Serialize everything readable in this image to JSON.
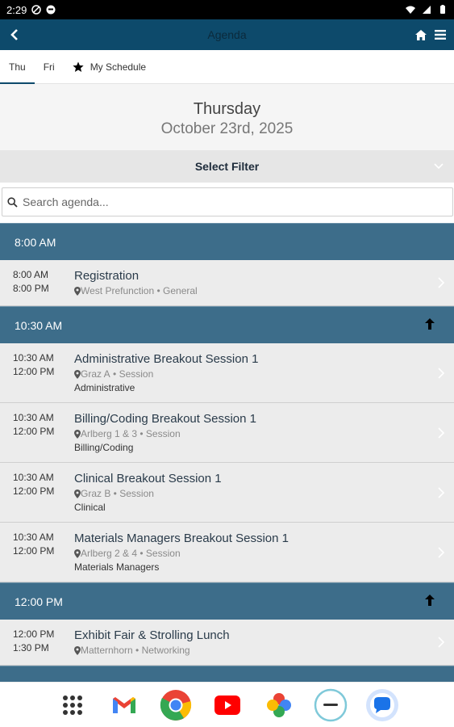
{
  "status_bar": {
    "time": "2:29"
  },
  "app_bar": {
    "title": "Agenda"
  },
  "tabs": [
    {
      "label": "Thu",
      "active": true
    },
    {
      "label": "Fri",
      "active": false
    },
    {
      "label": "My Schedule",
      "active": false,
      "icon": "star-icon"
    }
  ],
  "day": {
    "name": "Thursday",
    "date": "October 23rd, 2025"
  },
  "filter": {
    "label": "Select Filter"
  },
  "search": {
    "placeholder": "Search agenda..."
  },
  "groups": [
    {
      "time": "8:00 AM",
      "collapsible": false,
      "sessions": [
        {
          "start": "8:00 AM",
          "end": "8:00 PM",
          "title": "Registration",
          "location": "West Prefunction",
          "type": "General",
          "track": ""
        }
      ]
    },
    {
      "time": "10:30 AM",
      "collapsible": true,
      "sessions": [
        {
          "start": "10:30 AM",
          "end": "12:00 PM",
          "title": "Administrative Breakout Session 1",
          "location": "Graz A",
          "type": "Session",
          "track": "Administrative"
        },
        {
          "start": "10:30 AM",
          "end": "12:00 PM",
          "title": "Billing/Coding Breakout Session 1",
          "location": "Arlberg 1 & 3",
          "type": "Session",
          "track": "Billing/Coding"
        },
        {
          "start": "10:30 AM",
          "end": "12:00 PM",
          "title": "Clinical Breakout Session 1",
          "location": "Graz B",
          "type": "Session",
          "track": "Clinical"
        },
        {
          "start": "10:30 AM",
          "end": "12:00 PM",
          "title": "Materials Managers Breakout Session 1",
          "location": "Arlberg 2 & 4",
          "type": "Session",
          "track": "Materials Managers"
        }
      ]
    },
    {
      "time": "12:00 PM",
      "collapsible": true,
      "sessions": [
        {
          "start": "12:00 PM",
          "end": "1:30 PM",
          "title": "Exhibit Fair & Strolling Lunch",
          "location": "Matternhorn",
          "type": "Networking",
          "track": ""
        }
      ]
    }
  ],
  "dock": [
    "apps-grid-icon",
    "gmail-icon",
    "chrome-icon",
    "youtube-icon",
    "photos-icon",
    "app-circle-icon",
    "messages-icon"
  ],
  "colors": {
    "header": "#0d4a6b",
    "time_header": "#3d6d8a",
    "row_bg": "#ececec"
  }
}
